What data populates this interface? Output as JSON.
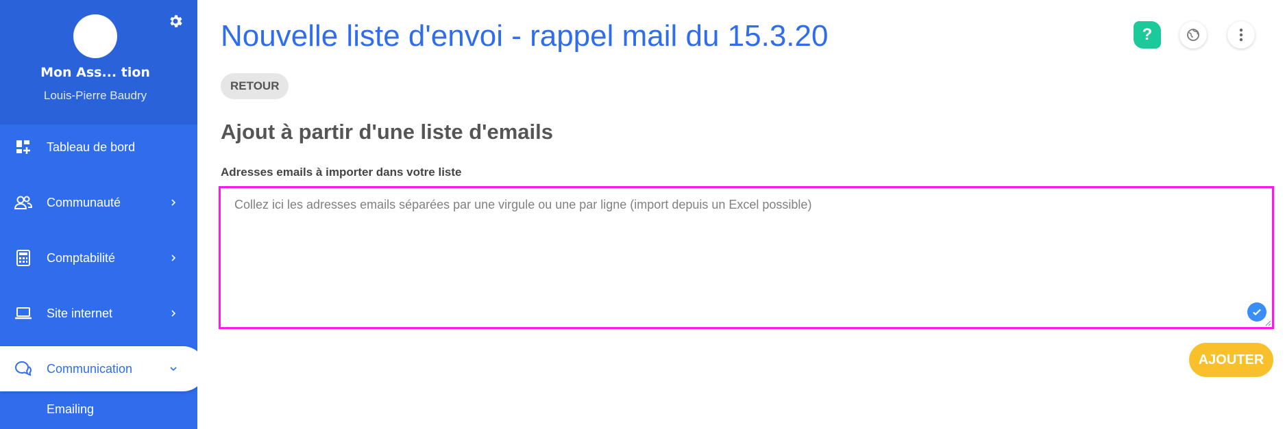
{
  "sidebar": {
    "org_name": "Mon Ass... tion",
    "user_name": "Louis-Pierre Baudry",
    "items": [
      {
        "label": "Tableau de bord",
        "icon": "dashboard-icon"
      },
      {
        "label": "Communauté",
        "icon": "community-icon"
      },
      {
        "label": "Comptabilité",
        "icon": "calculator-icon"
      },
      {
        "label": "Site internet",
        "icon": "laptop-icon"
      },
      {
        "label": "Communication",
        "icon": "chat-icon"
      }
    ],
    "sub_items": [
      {
        "label": "Emailing"
      }
    ]
  },
  "header": {
    "title": "Nouvelle liste d'envoi - rappel mail du 15.3.20",
    "help_label": "?"
  },
  "main": {
    "back_label": "RETOUR",
    "section_title": "Ajout à partir d'une liste d'emails",
    "field_label": "Adresses emails à importer dans votre liste",
    "textarea_placeholder": "Collez ici les adresses emails séparées par une virgule ou une par ligne (import depuis un Excel possible)",
    "textarea_value": "",
    "add_label": "AJOUTER"
  },
  "colors": {
    "sidebar": "#2f6ded",
    "accent": "#2f6ded",
    "help": "#1cc99b",
    "add_button": "#f8c02a",
    "focus_border": "#ff19e6"
  }
}
